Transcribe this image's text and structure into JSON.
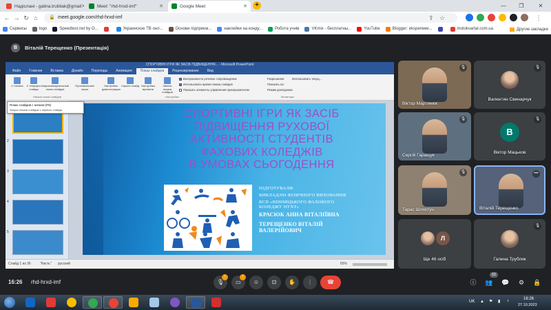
{
  "browser": {
    "tabs": [
      {
        "label": "Надіслані - galina.trubliak@gmail",
        "color": "#ea4335"
      },
      {
        "label": "Meet: \"rhd-hrxd-imf\"",
        "color": "#00832d"
      },
      {
        "label": "Google Meet",
        "color": "#00832d"
      }
    ],
    "url": "meet.google.com/rhd-hrxd-imf",
    "bookmarks": [
      {
        "label": "Сервисы",
        "color": "#4285f4"
      },
      {
        "label": "logo",
        "color": "#5f6368"
      },
      {
        "label": "Speedtest.net by O...",
        "color": "#141526"
      },
      {
        "label": "",
        "color": "#e53935"
      },
      {
        "label": "Украинское ТВ онл...",
        "color": "#1e88e5"
      },
      {
        "label": "Основи підприєм...",
        "color": "#6d4c41"
      },
      {
        "label": "наклейки на конду...",
        "color": "#4285f4"
      },
      {
        "label": "Робота учнів",
        "color": "#0f9d58"
      },
      {
        "label": "VKmix - бесплатны...",
        "color": "#4a76a8"
      },
      {
        "label": "YouTube",
        "color": "#ff0000"
      },
      {
        "label": "Blogger: eksperеме...",
        "color": "#f57c00"
      },
      {
        "label": "",
        "color": "#3949ab"
      },
      {
        "label": "motokvartal.com.ua",
        "color": "#e53935"
      }
    ],
    "bookmarks_more": "Другие закладки"
  },
  "meet": {
    "presenter_initial": "В",
    "presenter_label": "Віталій Терещенко (Презентація)",
    "meeting_time": "16:26",
    "meeting_code": "rhd-hrxd-imf",
    "participant_count": "63",
    "mic_badge": "!",
    "cam_badge": "!"
  },
  "powerpoint": {
    "window_title": "СПОРТИВНІ ІГРИ ЯК ЗАСІБ ПІДВИЩЕННЯ... - Microsoft PowerPoint",
    "tabs": [
      "Файл",
      "Главная",
      "Вставка",
      "Дизайн",
      "Переходы",
      "Анимация",
      "Показ слайдов",
      "Рецензирование",
      "Вид"
    ],
    "ribbon_buttons": [
      "С начала",
      "С текущего слайда",
      "Широковещательный показ слайдов",
      "Произвольный показ",
      "Настройка демонстрации",
      "Скрыть слайд",
      "Настройка времени",
      "Запись показа слайдов"
    ],
    "ribbon_groups": [
      "Начать показ слайдов",
      "Настройка",
      "Мониторы"
    ],
    "checkboxes": [
      "Воспроизвести речевое сопровождение",
      "Использовать время показа слайдов",
      "Показать элементы управления проигрывателем"
    ],
    "monitor_options": [
      "Разрешение:",
      "Использовать текущ...",
      "Показать на:",
      "Режим докладчика"
    ],
    "tooltip_title": "Показ слайдов с начала (F5)",
    "tooltip_desc": "Запуск показа слайдов с первого слайда.",
    "slide_numbers": [
      "1",
      "2",
      "3",
      "4",
      "5"
    ],
    "status_slide": "Слайд 1 из 36",
    "status_theme": "\"Кисть\"",
    "status_lang": "русский",
    "zoom": "65%"
  },
  "slide": {
    "title_lines": [
      "СПОРТИВНІ ІГРИ ЯК ЗАСІБ",
      "ПІДВИЩЕННЯ РУХОВОЇ",
      "АКТИВНОСТІ СТУДЕНТІВ",
      "ФАХОВИХ КОЛЕДЖІВ",
      "В УМОВАХ СЬОГОДЕННЯ"
    ],
    "prepared_label": "ПІДГОТУВАЛИ:",
    "role_1": "ВИКЛАДАЧІ ФІЗИЧНОГО ВИХОВАННЯ",
    "org_line_1": "ВСП «ВІННИЦЬКОГО ФАХОВОГО",
    "org_line_2": "КОЛЕДЖУ НУХТ»",
    "name_1": "КРАСЮК АННА ВІТАЛІЇВНА",
    "name_2_line_1": "ТЕРЕЩЕНКО ВІТАЛІЙ",
    "name_2_line_2": "ВАЛЕРІЙОВИЧ"
  },
  "participants": [
    {
      "name": "Віктор Мартинюк",
      "type": "video",
      "bg": "#7c6a55"
    },
    {
      "name": "Валентин Свинарчук",
      "type": "photo",
      "bg": "#3c4043"
    },
    {
      "name": "Сергій Гаращук",
      "type": "video",
      "bg": "#5e7080"
    },
    {
      "name": "Віктор Мацьков",
      "type": "avatar",
      "initial": "В",
      "bg": "#3c4043",
      "avatar_color": "#00796b"
    },
    {
      "name": "Тарас Шляхтун",
      "type": "video",
      "bg": "#8e8171"
    },
    {
      "name": "Віталій Терещенко",
      "type": "video",
      "bg": "#55627a"
    },
    {
      "name": "Ще 46 осіб",
      "type": "group",
      "initial": "Л",
      "bg": "#3c4043"
    },
    {
      "name": "Галина Трубляк",
      "type": "photo",
      "bg": "#3c4043"
    }
  ],
  "taskbar": {
    "lang": "UK",
    "time": "16:26",
    "date": "27.10.2023"
  }
}
